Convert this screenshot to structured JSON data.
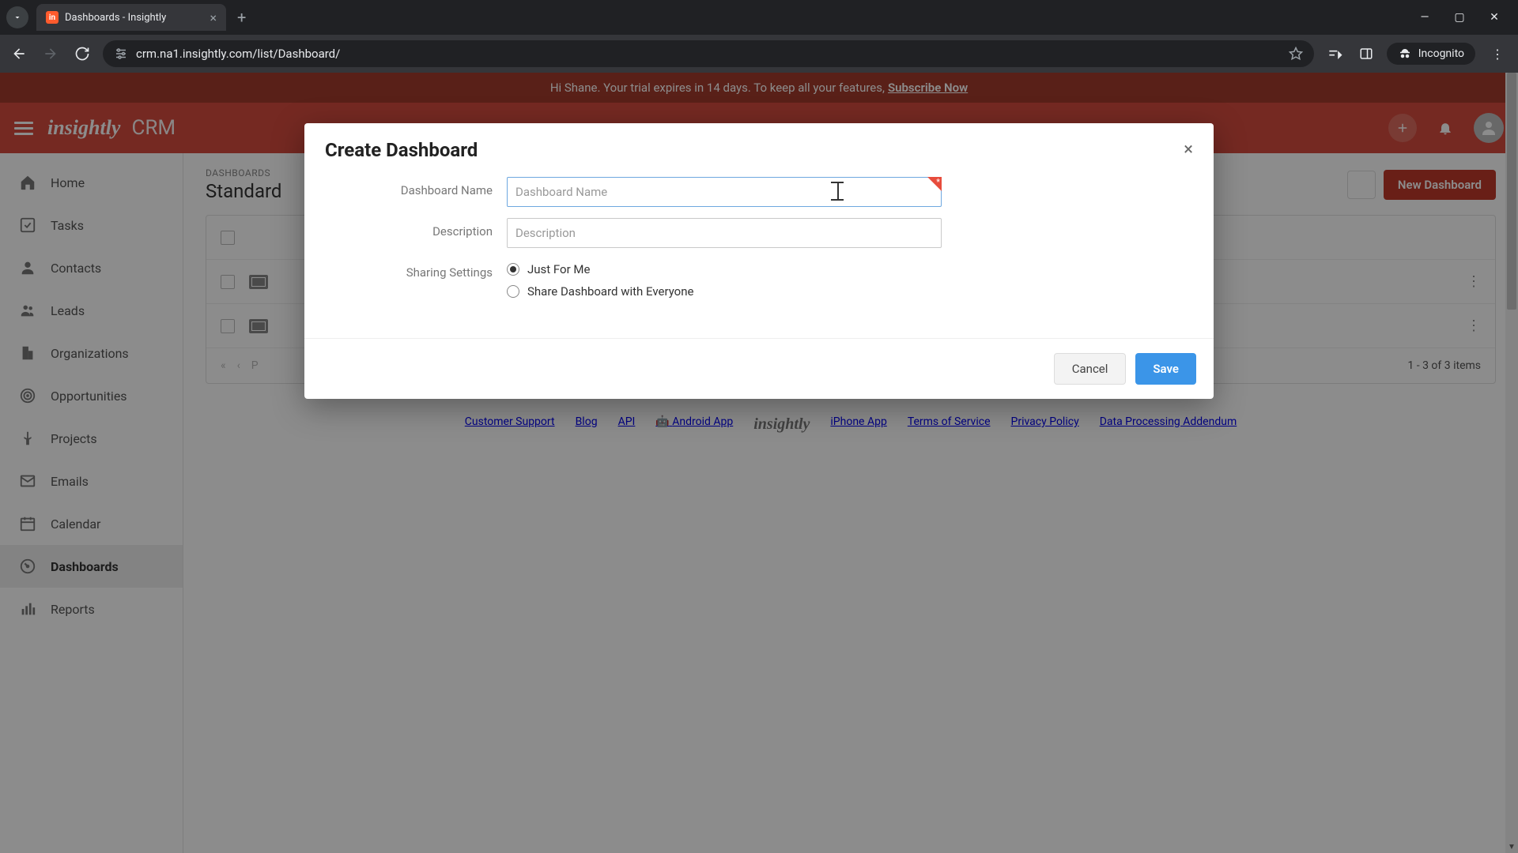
{
  "browser": {
    "tab_title": "Dashboards - Insightly",
    "url": "crm.na1.insightly.com/list/Dashboard/",
    "incognito_label": "Incognito"
  },
  "trial_banner": {
    "text_prefix": "Hi Shane. Your trial expires in 14 days. To keep all your features, ",
    "link": "Subscribe Now"
  },
  "header": {
    "brand": "insightly",
    "app": "CRM"
  },
  "sidebar": {
    "items": [
      {
        "label": "Home"
      },
      {
        "label": "Tasks"
      },
      {
        "label": "Contacts"
      },
      {
        "label": "Leads"
      },
      {
        "label": "Organizations"
      },
      {
        "label": "Opportunities"
      },
      {
        "label": "Projects"
      },
      {
        "label": "Emails"
      },
      {
        "label": "Calendar"
      },
      {
        "label": "Dashboards"
      },
      {
        "label": "Reports"
      }
    ]
  },
  "main": {
    "crumb": "DASHBOARDS",
    "title": "Standard",
    "new_button": "New Dashboard",
    "pager_label": "P",
    "count": "1 - 3 of 3 items"
  },
  "footer": {
    "links": [
      "Customer Support",
      "Blog",
      "API",
      "Android App",
      "",
      "iPhone App",
      "Terms of Service",
      "Privacy Policy",
      "Data Processing Addendum"
    ],
    "logo": "insightly"
  },
  "modal": {
    "title": "Create Dashboard",
    "name_label": "Dashboard Name",
    "name_placeholder": "Dashboard Name",
    "desc_label": "Description",
    "desc_placeholder": "Description",
    "sharing_label": "Sharing Settings",
    "radio1": "Just For Me",
    "radio2": "Share Dashboard with Everyone",
    "cancel": "Cancel",
    "save": "Save"
  }
}
